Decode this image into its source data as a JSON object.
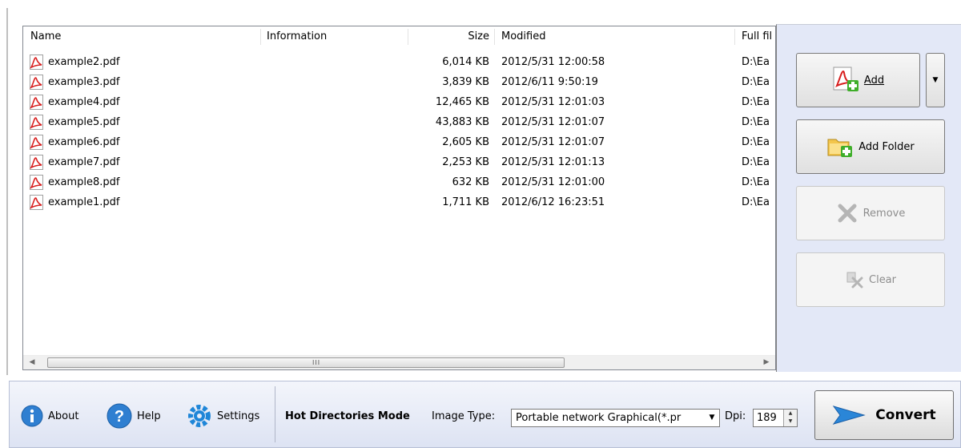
{
  "file_list": {
    "columns": {
      "name": "Name",
      "information": "Information",
      "size": "Size",
      "modified": "Modified",
      "full_path": "Full fil"
    },
    "rows": [
      {
        "name": "example2.pdf",
        "information": "",
        "size": "6,014 KB",
        "modified": "2012/5/31 12:00:58",
        "full_path": "D:\\Ea"
      },
      {
        "name": "example3.pdf",
        "information": "",
        "size": "3,839 KB",
        "modified": "2012/6/11 9:50:19",
        "full_path": "D:\\Ea"
      },
      {
        "name": "example4.pdf",
        "information": "",
        "size": "12,465 KB",
        "modified": "2012/5/31 12:01:03",
        "full_path": "D:\\Ea"
      },
      {
        "name": "example5.pdf",
        "information": "",
        "size": "43,883 KB",
        "modified": "2012/5/31 12:01:07",
        "full_path": "D:\\Ea"
      },
      {
        "name": "example6.pdf",
        "information": "",
        "size": "2,605 KB",
        "modified": "2012/5/31 12:01:07",
        "full_path": "D:\\Ea"
      },
      {
        "name": "example7.pdf",
        "information": "",
        "size": "2,253 KB",
        "modified": "2012/5/31 12:01:13",
        "full_path": "D:\\Ea"
      },
      {
        "name": "example8.pdf",
        "information": "",
        "size": "632 KB",
        "modified": "2012/5/31 12:01:00",
        "full_path": "D:\\Ea"
      },
      {
        "name": "example1.pdf",
        "information": "",
        "size": "1,711 KB",
        "modified": "2012/6/12 16:23:51",
        "full_path": "D:\\Ea"
      }
    ],
    "row_icon": "pdf-file-icon"
  },
  "right_panel": {
    "add": {
      "label": "Add",
      "icon": "add-pdf-icon"
    },
    "add_dropdown": {
      "icon": "dropdown-arrow-icon"
    },
    "add_folder": {
      "label": "Add Folder",
      "icon": "add-folder-icon"
    },
    "remove": {
      "label": "Remove",
      "icon": "remove-x-icon",
      "enabled": false
    },
    "clear": {
      "label": "Clear",
      "icon": "clear-broom-icon",
      "enabled": false
    }
  },
  "bottom_bar": {
    "about": {
      "label": "About",
      "icon": "info-icon"
    },
    "help": {
      "label": "Help",
      "icon": "help-icon"
    },
    "settings": {
      "label": "Settings",
      "icon": "gear-icon"
    },
    "hot_directories": "Hot Directories Mode",
    "image_type_label": "Image Type:",
    "image_type_value": "Portable network Graphical(*.pr",
    "dpi_label": "Dpi:",
    "dpi_value": "189",
    "convert": {
      "label": "Convert",
      "icon": "convert-arrow-icon"
    }
  },
  "colors": {
    "right_panel_bg": "#e3e8f7",
    "pdf_red": "#d81e1e",
    "convert_blue": "#2a86d8"
  }
}
